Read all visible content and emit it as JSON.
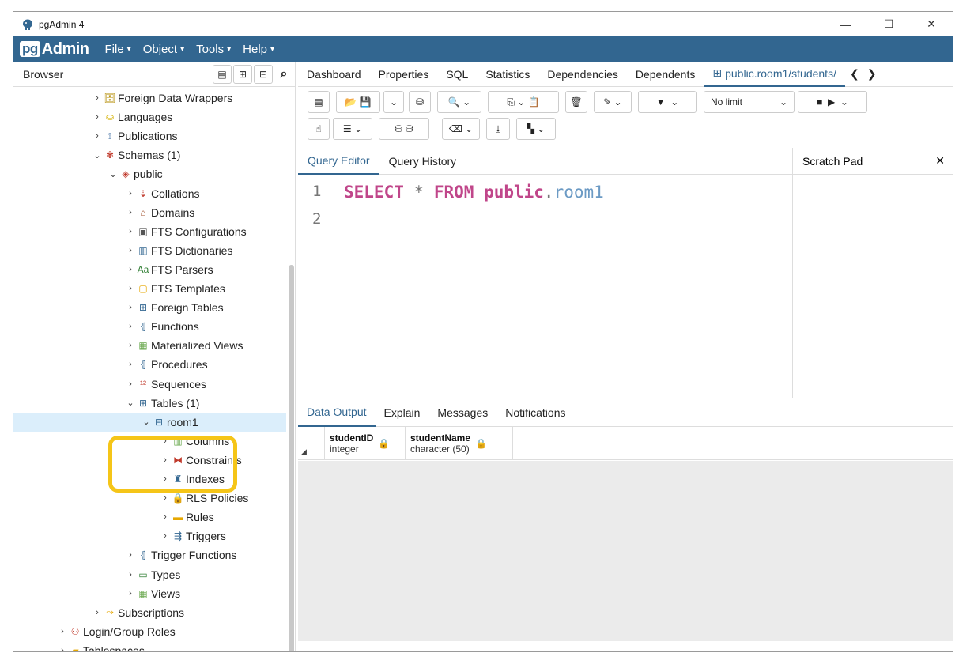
{
  "window": {
    "title": "pgAdmin 4",
    "controls": [
      "—",
      "☐",
      "✕"
    ]
  },
  "menubar": {
    "logo_pg": "pg",
    "logo_admin": "Admin",
    "items": [
      "File",
      "Object",
      "Tools",
      "Help"
    ]
  },
  "browser": {
    "label": "Browser"
  },
  "tree": [
    {
      "label": "Foreign Data Wrappers",
      "icon": "fdw-icon"
    },
    {
      "label": "Languages",
      "icon": "languages-icon"
    },
    {
      "label": "Publications",
      "icon": "publications-icon"
    },
    {
      "label": "Schemas (1)",
      "icon": "schemas-icon"
    },
    {
      "label": "public",
      "icon": "schema-icon"
    },
    {
      "label": "Collations",
      "icon": "collations-icon"
    },
    {
      "label": "Domains",
      "icon": "domains-icon"
    },
    {
      "label": "FTS Configurations",
      "icon": "fts-config-icon"
    },
    {
      "label": "FTS Dictionaries",
      "icon": "fts-dict-icon"
    },
    {
      "label": "FTS Parsers",
      "icon": "fts-parser-icon"
    },
    {
      "label": "FTS Templates",
      "icon": "fts-template-icon"
    },
    {
      "label": "Foreign Tables",
      "icon": "foreign-tables-icon"
    },
    {
      "label": "Functions",
      "icon": "functions-icon"
    },
    {
      "label": "Materialized Views",
      "icon": "matviews-icon"
    },
    {
      "label": "Procedures",
      "icon": "procedures-icon"
    },
    {
      "label": "Sequences",
      "icon": "sequences-icon"
    },
    {
      "label": "Tables (1)",
      "icon": "tables-icon"
    },
    {
      "label": "room1",
      "icon": "table-icon"
    },
    {
      "label": "Columns",
      "icon": "columns-icon"
    },
    {
      "label": "Constraints",
      "icon": "constraints-icon"
    },
    {
      "label": "Indexes",
      "icon": "indexes-icon"
    },
    {
      "label": "RLS Policies",
      "icon": "rls-icon"
    },
    {
      "label": "Rules",
      "icon": "rules-icon"
    },
    {
      "label": "Triggers",
      "icon": "triggers-icon"
    },
    {
      "label": "Trigger Functions",
      "icon": "trigger-functions-icon"
    },
    {
      "label": "Types",
      "icon": "types-icon"
    },
    {
      "label": "Views",
      "icon": "views-icon"
    },
    {
      "label": "Subscriptions",
      "icon": "subscriptions-icon"
    },
    {
      "label": "Login/Group Roles",
      "icon": "roles-icon"
    },
    {
      "label": "Tablespaces",
      "icon": "tablespaces-icon"
    }
  ],
  "tabs": [
    "Dashboard",
    "Properties",
    "SQL",
    "Statistics",
    "Dependencies",
    "Dependents",
    "public.room1/students/"
  ],
  "toolbar": {
    "limit": "No limit"
  },
  "query_tabs": [
    "Query Editor",
    "Query History"
  ],
  "scratch": {
    "title": "Scratch Pad",
    "close": "✕"
  },
  "editor": {
    "line_numbers": [
      "1",
      "2"
    ],
    "select": "SELECT",
    "star": "*",
    "from": "FROM",
    "schema": "public",
    "dot": ".",
    "table": "room1"
  },
  "result_tabs": [
    "Data Output",
    "Explain",
    "Messages",
    "Notifications"
  ],
  "columns": [
    {
      "name": "studentID",
      "type": "integer"
    },
    {
      "name": "studentName",
      "type": "character (50)"
    }
  ],
  "colors": {
    "brand": "#326690",
    "highlight": "#f5c518",
    "selection": "#dbeefb"
  }
}
